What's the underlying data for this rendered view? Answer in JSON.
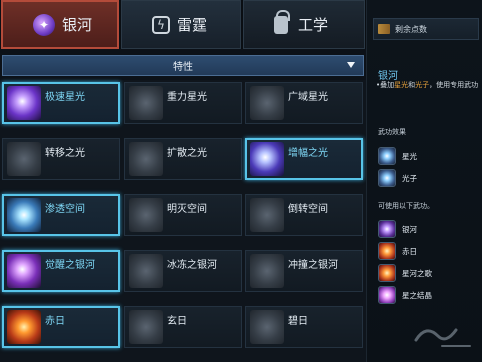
{
  "tabs": [
    {
      "label": "银河",
      "icon": "galaxy-icon",
      "active": true
    },
    {
      "label": "雷霆",
      "icon": "thunder-icon",
      "active": false
    },
    {
      "label": "工学",
      "icon": "lock-icon",
      "active": false
    }
  ],
  "dropdown": {
    "label": "特性"
  },
  "skills": [
    {
      "label": "极速星光",
      "active": true
    },
    {
      "label": "重力星光",
      "active": false
    },
    {
      "label": "广域星光",
      "active": false
    },
    {
      "label": "转移之光",
      "active": false
    },
    {
      "label": "扩散之光",
      "active": false
    },
    {
      "label": "增幅之光",
      "active": true
    },
    {
      "label": "渗透空间",
      "active": true
    },
    {
      "label": "明灭空间",
      "active": false
    },
    {
      "label": "倒转空间",
      "active": false
    },
    {
      "label": "觉醒之银河",
      "active": true
    },
    {
      "label": "冰冻之银河",
      "active": false
    },
    {
      "label": "冲撞之银河",
      "active": false
    },
    {
      "label": "赤日",
      "active": true
    },
    {
      "label": "玄日",
      "active": false
    },
    {
      "label": "碧日",
      "active": false
    }
  ],
  "right_panel": {
    "points_label": "剩余点数",
    "title": "银河",
    "desc_prefix": "•叠加",
    "desc_hl1": "星光",
    "desc_mid": "和",
    "desc_hl2": "光子",
    "desc_suffix": "，使用专用武功",
    "effects_label": "武功效果",
    "effects": [
      {
        "label": "星光"
      },
      {
        "label": "光子"
      }
    ],
    "usable_label": "可使用以下武功。",
    "usable": [
      {
        "label": "银河"
      },
      {
        "label": "赤日"
      },
      {
        "label": "星河之歌"
      },
      {
        "label": "星之结晶"
      }
    ]
  },
  "colors": {
    "accent": "#58c4e8",
    "active_tab": "#6e2f27",
    "highlight": "#e9a33c"
  }
}
